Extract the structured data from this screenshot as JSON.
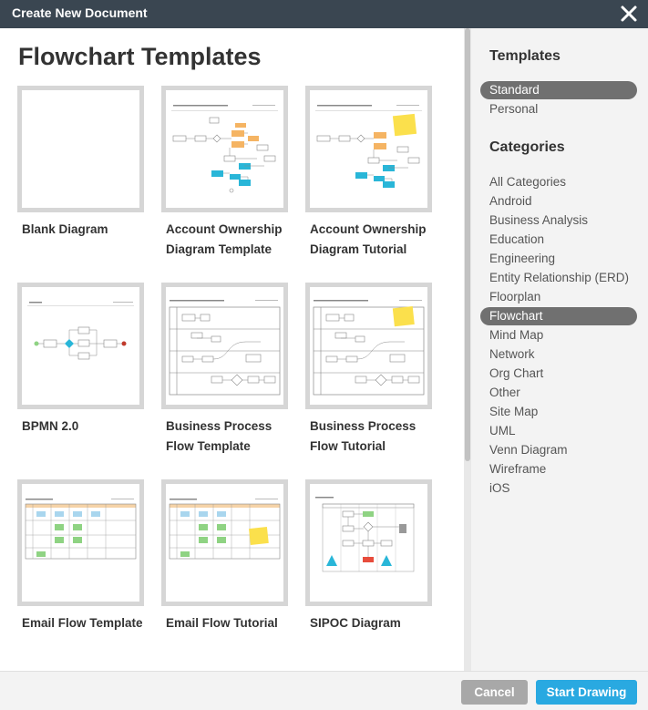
{
  "window": {
    "title": "Create New Document"
  },
  "main": {
    "heading": "Flowchart Templates",
    "templates": [
      {
        "line1": "Blank Diagram",
        "line2": ""
      },
      {
        "line1": "Account Ownership",
        "line2": "Diagram Template"
      },
      {
        "line1": "Account Ownership",
        "line2": "Diagram Tutorial"
      },
      {
        "line1": "BPMN 2.0",
        "line2": ""
      },
      {
        "line1": "Business Process",
        "line2": "Flow Template"
      },
      {
        "line1": "Business Process",
        "line2": "Flow Tutorial"
      },
      {
        "line1": "Email Flow Template",
        "line2": ""
      },
      {
        "line1": "Email Flow Tutorial",
        "line2": ""
      },
      {
        "line1": "SIPOC Diagram",
        "line2": ""
      }
    ]
  },
  "sidebar": {
    "templates_heading": "Templates",
    "template_types": [
      "Standard",
      "Personal"
    ],
    "selected_type": "Standard",
    "categories_heading": "Categories",
    "categories": [
      "All Categories",
      "Android",
      "Business Analysis",
      "Education",
      "Engineering",
      "Entity Relationship (ERD)",
      "Floorplan",
      "Flowchart",
      "Mind Map",
      "Network",
      "Org Chart",
      "Other",
      "Site Map",
      "UML",
      "Venn Diagram",
      "Wireframe",
      "iOS"
    ],
    "selected_category": "Flowchart"
  },
  "footer": {
    "cancel_label": "Cancel",
    "start_label": "Start Drawing"
  },
  "colors": {
    "accent": "#29a9e1",
    "titlebar": "#3a4651",
    "selected": "#707070",
    "note": "#fbe04c",
    "orange": "#f5b463",
    "cyan": "#29b6d8",
    "green": "#8fd383"
  }
}
